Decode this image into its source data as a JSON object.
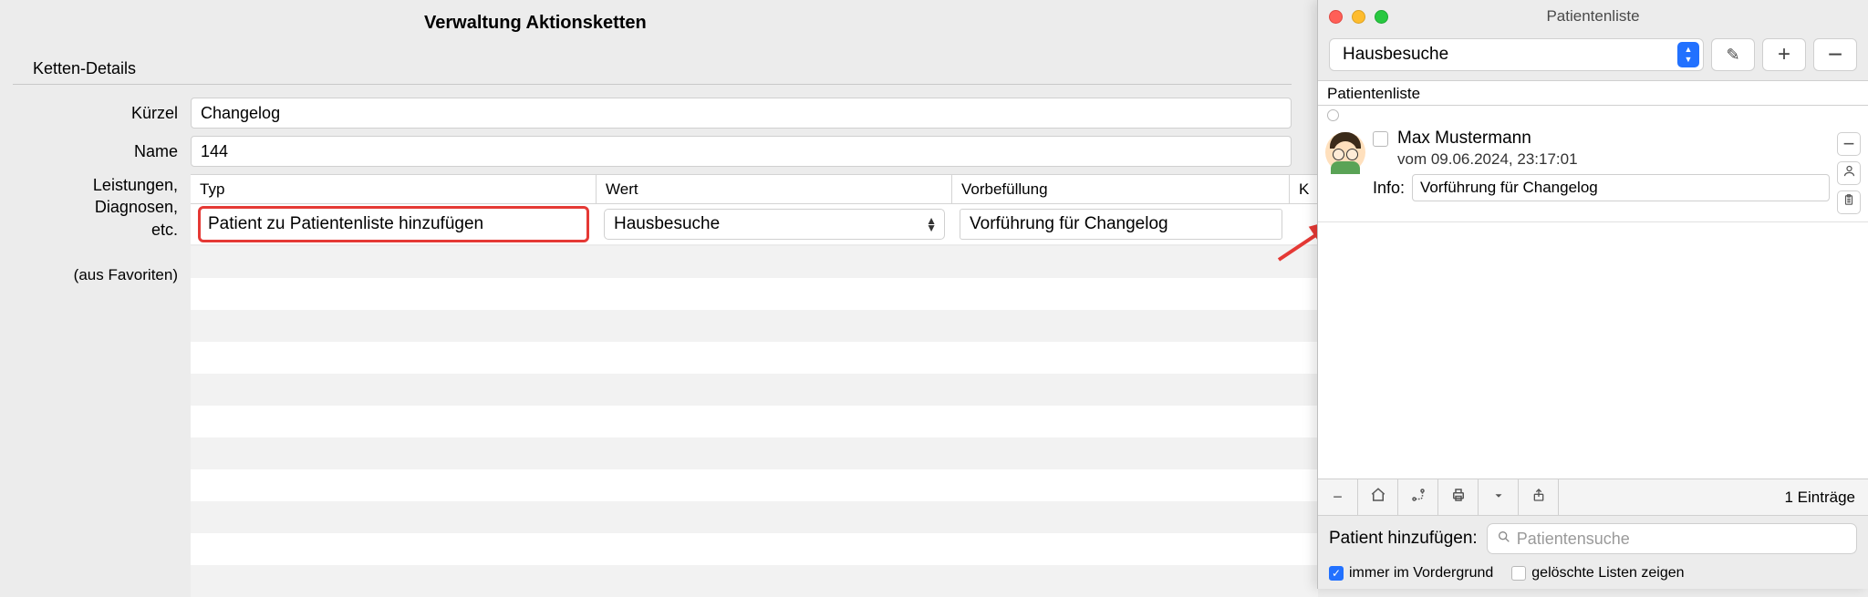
{
  "main": {
    "title": "Verwaltung Aktionsketten",
    "section": "Ketten-Details",
    "labels": {
      "kuerzel": "Kürzel",
      "name": "Name",
      "leistungen": "Leistungen,\nDiagnosen,\netc.",
      "favoriten": "(aus Favoriten)"
    },
    "values": {
      "kuerzel": "Changelog",
      "name": "144"
    },
    "table": {
      "headers": {
        "typ": "Typ",
        "wert": "Wert",
        "vor": "Vorbefüllung",
        "last": "K"
      },
      "row": {
        "typ": "Patient zu Patientenliste hinzufügen",
        "wert": "Hausbesuche",
        "vor": "Vorführung für Changelog"
      }
    }
  },
  "sidewin": {
    "title": "Patientenliste",
    "list_select": "Hausbesuche",
    "list_caption": "Patientenliste",
    "patient": {
      "name": "Max Mustermann",
      "date": "vom 09.06.2024, 23:17:01",
      "info_label": "Info:",
      "info_value": "Vorführung für Changelog"
    },
    "count": "1 Einträge",
    "add_label": "Patient hinzufügen:",
    "search_placeholder": "Patientensuche",
    "checks": {
      "foreground": "immer im Vordergrund",
      "deleted": "gelöschte Listen zeigen"
    }
  }
}
